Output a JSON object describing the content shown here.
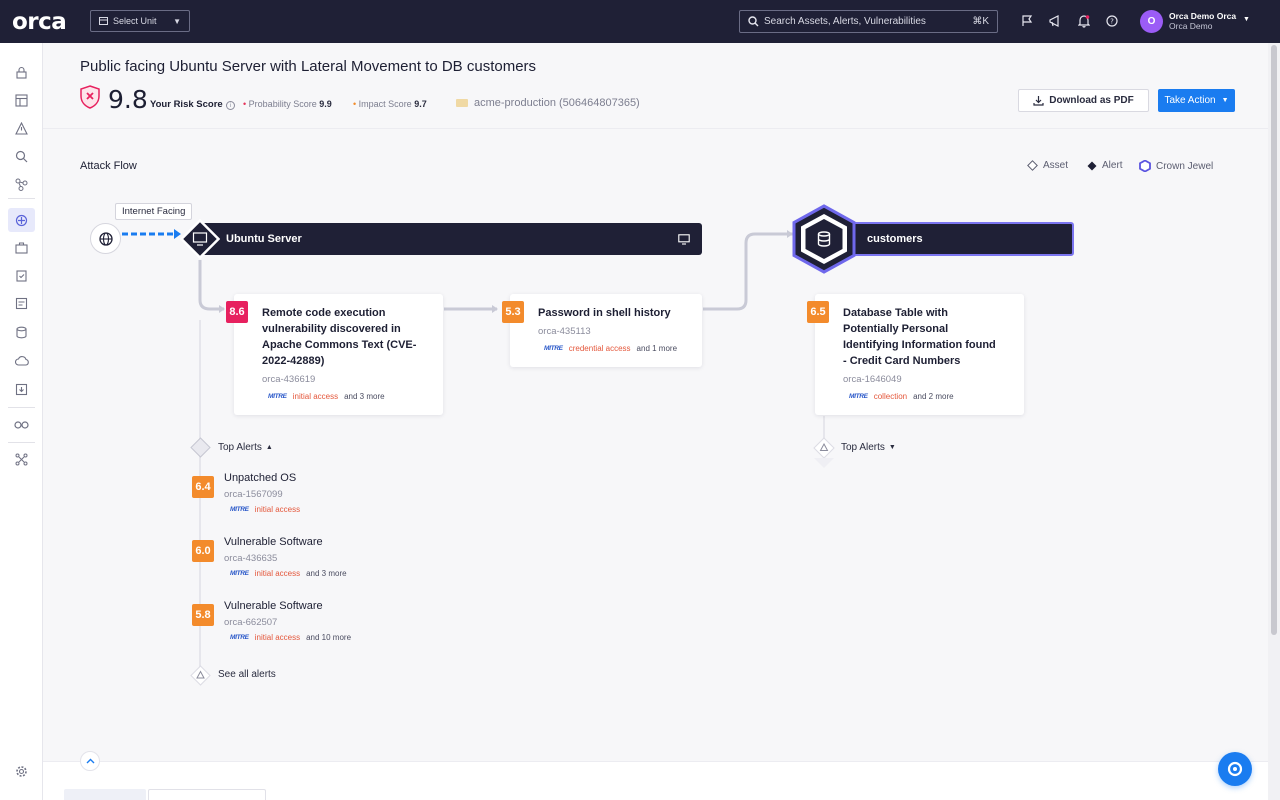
{
  "topbar": {
    "logo": "orca",
    "select_unit": "Select Unit",
    "search_placeholder": "Search Assets, Alerts, Vulnerabilities",
    "search_shortcut": "⌘K",
    "user_name": "Orca Demo Orca",
    "user_org": "Orca Demo",
    "avatar_initial": "O"
  },
  "header": {
    "title": "Public facing Ubuntu Server with Lateral Movement to DB customers",
    "risk_score": "9.8",
    "risk_label": "Your Risk Score",
    "probability_label": "Probability Score",
    "probability_value": "9.9",
    "impact_label": "Impact Score",
    "impact_value": "9.7",
    "account": "acme-production (506464807365)",
    "download_label": "Download as PDF",
    "action_label": "Take Action"
  },
  "flow": {
    "section_title": "Attack Flow",
    "legend": {
      "asset": "Asset",
      "alert": "Alert",
      "crown": "Crown Jewel"
    },
    "tooltip": "Internet Facing",
    "assets": [
      {
        "name": "Ubuntu Server"
      },
      {
        "name": "customers"
      }
    ],
    "cards": [
      {
        "score": "8.6",
        "title_lines": [
          "Remote code execution",
          "vulnerability discovered in",
          "Apache Commons Text (CVE-",
          "2022-42889)"
        ],
        "id": "orca-436619",
        "tactic": "initial access",
        "more": "and 3 more"
      },
      {
        "score": "5.3",
        "title_lines": [
          "Password in shell history"
        ],
        "id": "orca-435113",
        "tactic": "credential access",
        "more": "and 1 more"
      },
      {
        "score": "6.5",
        "title_lines": [
          "Database Table with",
          "Potentially Personal",
          "Identifying Information found",
          "- Credit Card Numbers"
        ],
        "id": "orca-1646049",
        "tactic": "collection",
        "more": "and 2 more"
      }
    ],
    "mitre_label": "MITRE",
    "top_alerts_label": "Top Alerts",
    "top_alerts": [
      {
        "score": "6.4",
        "title": "Unpatched OS",
        "id": "orca-1567099",
        "tactic": "initial access",
        "more": ""
      },
      {
        "score": "6.0",
        "title": "Vulnerable Software",
        "id": "orca-436635",
        "tactic": "initial access",
        "more": "and 3 more"
      },
      {
        "score": "5.8",
        "title": "Vulnerable Software",
        "id": "orca-662507",
        "tactic": "initial access",
        "more": "and 10 more"
      }
    ],
    "see_all": "See all alerts"
  },
  "colors": {
    "navy": "#1f2036",
    "accent_blue": "#1a7cf0",
    "score_red": "#e7215f",
    "score_orange": "#f38b2c",
    "crown_purple": "#5b54e0"
  }
}
